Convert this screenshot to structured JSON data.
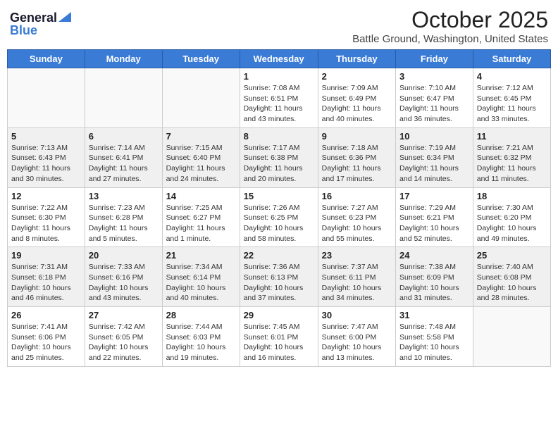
{
  "header": {
    "logo_general": "General",
    "logo_blue": "Blue",
    "month_title": "October 2025",
    "location": "Battle Ground, Washington, United States"
  },
  "days_of_week": [
    "Sunday",
    "Monday",
    "Tuesday",
    "Wednesday",
    "Thursday",
    "Friday",
    "Saturday"
  ],
  "weeks": [
    [
      {
        "day": null,
        "info": null
      },
      {
        "day": null,
        "info": null
      },
      {
        "day": null,
        "info": null
      },
      {
        "day": "1",
        "info": "Sunrise: 7:08 AM\nSunset: 6:51 PM\nDaylight: 11 hours and 43 minutes."
      },
      {
        "day": "2",
        "info": "Sunrise: 7:09 AM\nSunset: 6:49 PM\nDaylight: 11 hours and 40 minutes."
      },
      {
        "day": "3",
        "info": "Sunrise: 7:10 AM\nSunset: 6:47 PM\nDaylight: 11 hours and 36 minutes."
      },
      {
        "day": "4",
        "info": "Sunrise: 7:12 AM\nSunset: 6:45 PM\nDaylight: 11 hours and 33 minutes."
      }
    ],
    [
      {
        "day": "5",
        "info": "Sunrise: 7:13 AM\nSunset: 6:43 PM\nDaylight: 11 hours and 30 minutes."
      },
      {
        "day": "6",
        "info": "Sunrise: 7:14 AM\nSunset: 6:41 PM\nDaylight: 11 hours and 27 minutes."
      },
      {
        "day": "7",
        "info": "Sunrise: 7:15 AM\nSunset: 6:40 PM\nDaylight: 11 hours and 24 minutes."
      },
      {
        "day": "8",
        "info": "Sunrise: 7:17 AM\nSunset: 6:38 PM\nDaylight: 11 hours and 20 minutes."
      },
      {
        "day": "9",
        "info": "Sunrise: 7:18 AM\nSunset: 6:36 PM\nDaylight: 11 hours and 17 minutes."
      },
      {
        "day": "10",
        "info": "Sunrise: 7:19 AM\nSunset: 6:34 PM\nDaylight: 11 hours and 14 minutes."
      },
      {
        "day": "11",
        "info": "Sunrise: 7:21 AM\nSunset: 6:32 PM\nDaylight: 11 hours and 11 minutes."
      }
    ],
    [
      {
        "day": "12",
        "info": "Sunrise: 7:22 AM\nSunset: 6:30 PM\nDaylight: 11 hours and 8 minutes."
      },
      {
        "day": "13",
        "info": "Sunrise: 7:23 AM\nSunset: 6:28 PM\nDaylight: 11 hours and 5 minutes."
      },
      {
        "day": "14",
        "info": "Sunrise: 7:25 AM\nSunset: 6:27 PM\nDaylight: 11 hours and 1 minute."
      },
      {
        "day": "15",
        "info": "Sunrise: 7:26 AM\nSunset: 6:25 PM\nDaylight: 10 hours and 58 minutes."
      },
      {
        "day": "16",
        "info": "Sunrise: 7:27 AM\nSunset: 6:23 PM\nDaylight: 10 hours and 55 minutes."
      },
      {
        "day": "17",
        "info": "Sunrise: 7:29 AM\nSunset: 6:21 PM\nDaylight: 10 hours and 52 minutes."
      },
      {
        "day": "18",
        "info": "Sunrise: 7:30 AM\nSunset: 6:20 PM\nDaylight: 10 hours and 49 minutes."
      }
    ],
    [
      {
        "day": "19",
        "info": "Sunrise: 7:31 AM\nSunset: 6:18 PM\nDaylight: 10 hours and 46 minutes."
      },
      {
        "day": "20",
        "info": "Sunrise: 7:33 AM\nSunset: 6:16 PM\nDaylight: 10 hours and 43 minutes."
      },
      {
        "day": "21",
        "info": "Sunrise: 7:34 AM\nSunset: 6:14 PM\nDaylight: 10 hours and 40 minutes."
      },
      {
        "day": "22",
        "info": "Sunrise: 7:36 AM\nSunset: 6:13 PM\nDaylight: 10 hours and 37 minutes."
      },
      {
        "day": "23",
        "info": "Sunrise: 7:37 AM\nSunset: 6:11 PM\nDaylight: 10 hours and 34 minutes."
      },
      {
        "day": "24",
        "info": "Sunrise: 7:38 AM\nSunset: 6:09 PM\nDaylight: 10 hours and 31 minutes."
      },
      {
        "day": "25",
        "info": "Sunrise: 7:40 AM\nSunset: 6:08 PM\nDaylight: 10 hours and 28 minutes."
      }
    ],
    [
      {
        "day": "26",
        "info": "Sunrise: 7:41 AM\nSunset: 6:06 PM\nDaylight: 10 hours and 25 minutes."
      },
      {
        "day": "27",
        "info": "Sunrise: 7:42 AM\nSunset: 6:05 PM\nDaylight: 10 hours and 22 minutes."
      },
      {
        "day": "28",
        "info": "Sunrise: 7:44 AM\nSunset: 6:03 PM\nDaylight: 10 hours and 19 minutes."
      },
      {
        "day": "29",
        "info": "Sunrise: 7:45 AM\nSunset: 6:01 PM\nDaylight: 10 hours and 16 minutes."
      },
      {
        "day": "30",
        "info": "Sunrise: 7:47 AM\nSunset: 6:00 PM\nDaylight: 10 hours and 13 minutes."
      },
      {
        "day": "31",
        "info": "Sunrise: 7:48 AM\nSunset: 5:58 PM\nDaylight: 10 hours and 10 minutes."
      },
      {
        "day": null,
        "info": null
      }
    ]
  ]
}
